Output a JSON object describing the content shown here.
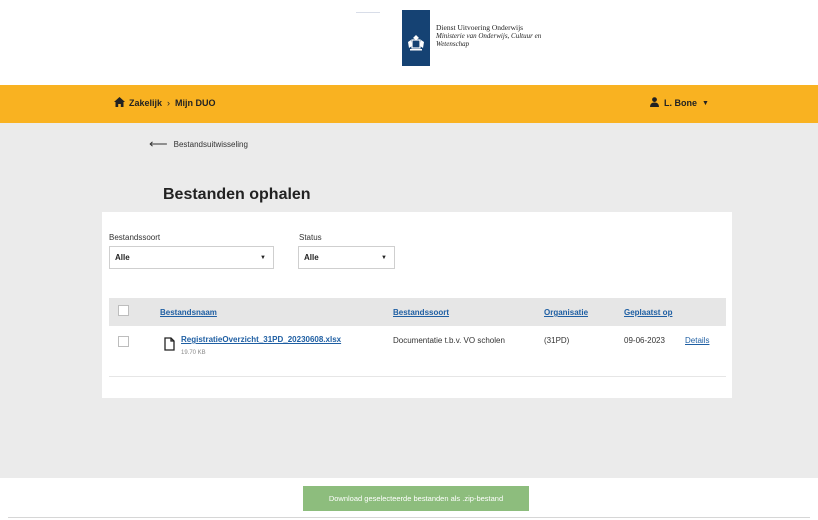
{
  "header": {
    "org_name": "Dienst Uitvoering Onderwijs",
    "ministry": "Ministerie van Onderwijs, Cultuur en Wetenschap"
  },
  "nav": {
    "crumb_1": "Zakelijk",
    "separator": "›",
    "crumb_2": "Mijn DUO",
    "user_name": "L. Bone"
  },
  "page": {
    "back_label": "Bestandsuitwisseling",
    "title": "Bestanden ophalen"
  },
  "filters": {
    "type_label": "Bestandssoort",
    "type_value": "Alle",
    "status_label": "Status",
    "status_value": "Alle"
  },
  "table": {
    "columns": [
      "Bestandsnaam",
      "Bestandssoort",
      "Organisatie",
      "Geplaatst op"
    ],
    "rows": [
      {
        "name": "RegistratieOverzicht_31PD_20230608.xlsx",
        "size": "19.70 KB",
        "type": "Documentatie t.b.v. VO scholen",
        "org": "(31PD)",
        "date": "09-06-2023",
        "action": "Details"
      }
    ]
  },
  "footer": {
    "download_label": "Download geselecteerde bestanden als .zip-bestand"
  },
  "colors": {
    "nav_bar": "#f9b221",
    "content_bg": "#ebebeb",
    "link": "#1f5fa3",
    "download_button": "#8dbd7d",
    "emblem": "#154273"
  },
  "icons": [
    "home-icon",
    "user-icon",
    "caret-down-icon",
    "back-arrow-icon",
    "file-icon",
    "checkbox"
  ]
}
